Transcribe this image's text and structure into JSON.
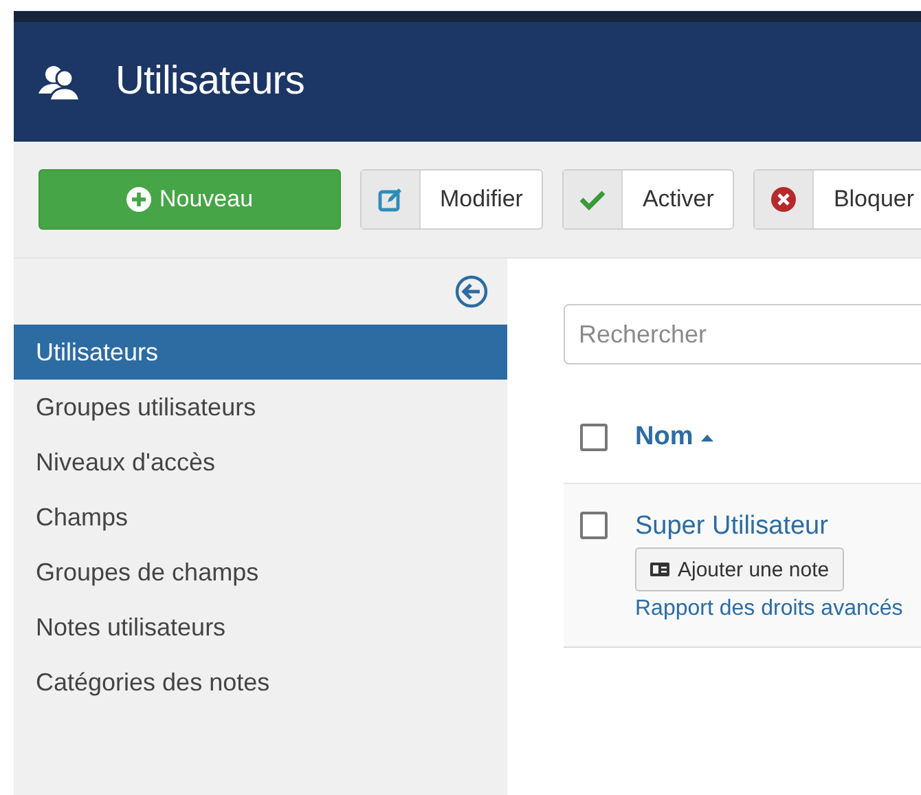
{
  "header": {
    "title": "Utilisateurs"
  },
  "toolbar": {
    "buttons": [
      {
        "label": "Nouveau",
        "kind": "new"
      },
      {
        "label": "Modifier",
        "kind": "edit"
      },
      {
        "label": "Activer",
        "kind": "publish"
      },
      {
        "label": "Bloquer",
        "kind": "block"
      }
    ]
  },
  "sidebar": {
    "items": [
      {
        "label": "Utilisateurs",
        "selected": true
      },
      {
        "label": "Groupes utilisateurs",
        "selected": false
      },
      {
        "label": "Niveaux d'accès",
        "selected": false
      },
      {
        "label": "Champs",
        "selected": false
      },
      {
        "label": "Groupes de champs",
        "selected": false
      },
      {
        "label": "Notes utilisateurs",
        "selected": false
      },
      {
        "label": "Catégories des notes",
        "selected": false
      }
    ]
  },
  "search": {
    "placeholder": "Rechercher"
  },
  "table": {
    "select_all_checked": false,
    "columns": [
      {
        "label": "Nom",
        "sorted_ascending": true
      }
    ],
    "rows": [
      {
        "name": "Super Utilisateur",
        "checked": false,
        "note_button": "Ajouter une note",
        "link": "Rapport des droits avancés"
      }
    ]
  }
}
